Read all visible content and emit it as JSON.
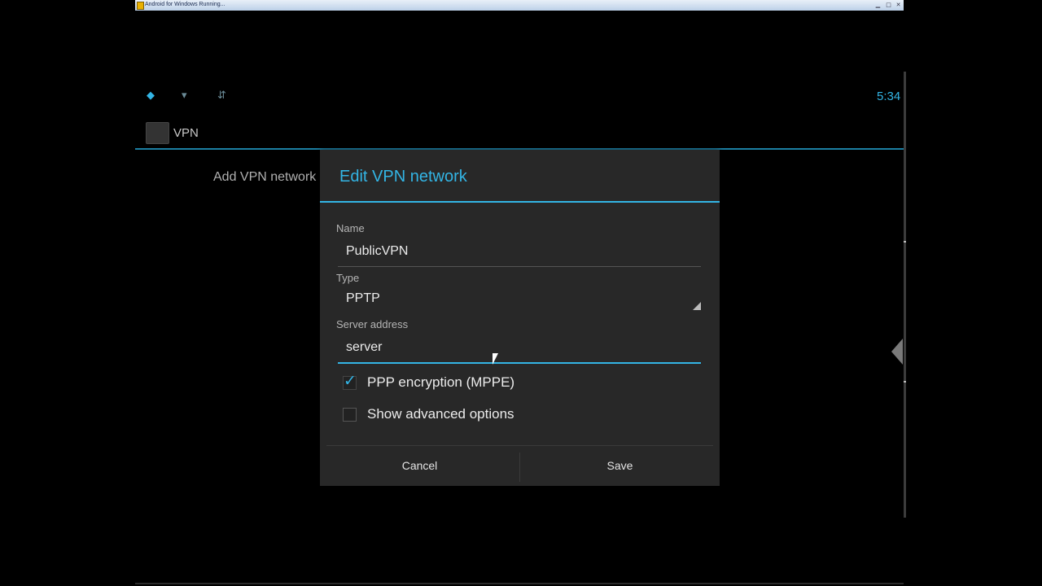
{
  "window": {
    "title": "Android for Windows Running..."
  },
  "status_bar": {
    "time": "5:34"
  },
  "action_bar": {
    "title": "VPN"
  },
  "background_list": {
    "add_item": "Add VPN network"
  },
  "dialog": {
    "title": "Edit VPN network",
    "name": {
      "label": "Name",
      "value": "PublicVPN"
    },
    "type": {
      "label": "Type",
      "value": "PPTP"
    },
    "server": {
      "label": "Server address",
      "value": "server"
    },
    "ppp_encryption": {
      "label": "PPP encryption (MPPE)",
      "checked": true
    },
    "advanced": {
      "label": "Show advanced options",
      "checked": false
    },
    "cancel_label": "Cancel",
    "save_label": "Save"
  },
  "colors": {
    "accent": "#33b5e5",
    "dialog_bg": "#282828",
    "screen_bg": "#000000"
  }
}
